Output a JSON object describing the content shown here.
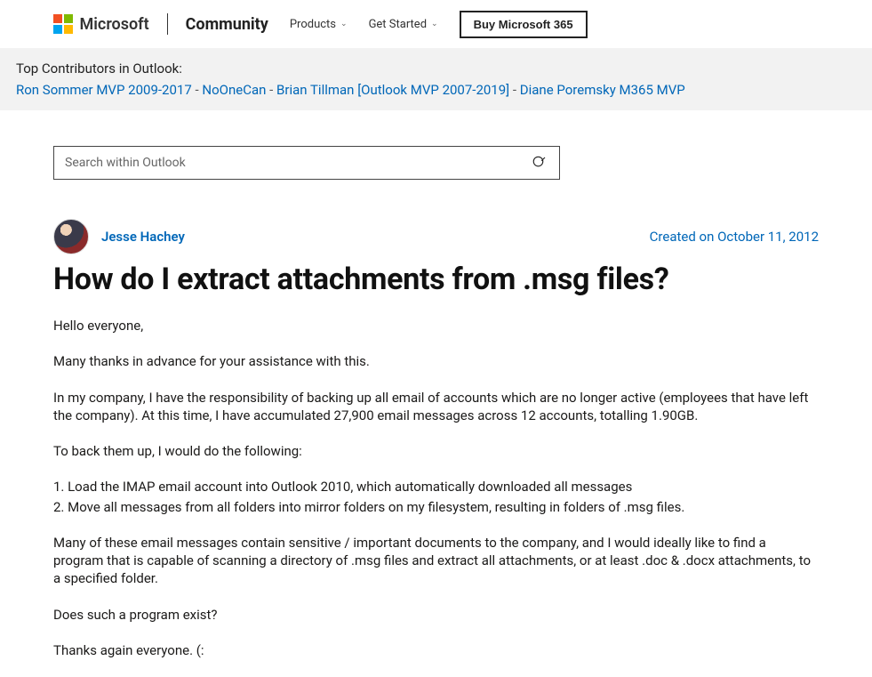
{
  "header": {
    "brand": "Microsoft",
    "community": "Community",
    "nav": {
      "products": "Products",
      "getStarted": "Get Started"
    },
    "buy": "Buy Microsoft 365"
  },
  "contributors": {
    "label": "Top Contributors in Outlook:",
    "links": [
      "Ron Sommer MVP 2009-2017",
      "NoOneCan",
      "Brian Tillman [Outlook MVP 2007-2019]",
      "Diane Poremsky M365 MVP"
    ],
    "sep": "-"
  },
  "search": {
    "placeholder": "Search within Outlook"
  },
  "post": {
    "author": "Jesse Hachey",
    "created": "Created on October 11, 2012",
    "title": "How do I extract attachments from .msg files?",
    "body": {
      "p1": "Hello everyone,",
      "p2": "Many thanks in advance for your assistance with this.",
      "p3": "In my company, I have the responsibility of backing up all email of accounts which are no longer active (employees that have left the company). At this time, I have accumulated 27,900 email messages across 12 accounts, totalling 1.90GB.",
      "p4": "To back them up, I would do the following:",
      "l1": "1. Load the IMAP email account into Outlook 2010, which automatically downloaded all messages",
      "l2": "2. Move all messages from all folders into mirror folders on my filesystem, resulting in folders of .msg files.",
      "p5": "Many of these email messages contain sensitive / important documents to the company, and I would ideally like to find a program that is capable of scanning a directory of .msg files and extract all attachments, or at least .doc & .docx attachments, to a specified folder.",
      "p6": "Does such a program exist?",
      "p7": "Thanks again everyone. (:"
    }
  }
}
